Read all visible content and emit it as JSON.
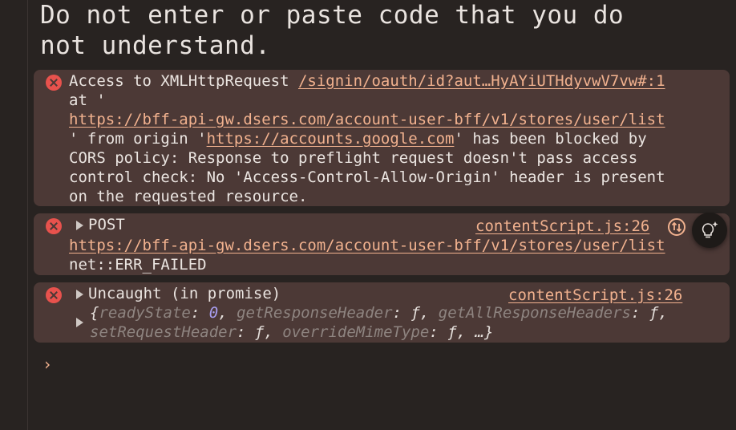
{
  "warning": {
    "line1": "Do not enter or paste code that you do",
    "line2": "not understand."
  },
  "cors_error": {
    "prefix": "Access to XMLHttpRequest ",
    "source_link": "/signin/oauth/id?aut…HyAYiUTHdyvwV7vw#:1",
    "line2": "at '",
    "url": "https://bff-api-gw.dsers.com/account-user-bff/v1/stores/user/list",
    "line4_pre": "' from origin '",
    "origin": "https://accounts.google.com",
    "line4_post": "' has been blocked by",
    "line5": "CORS policy: Response to preflight request doesn't pass access",
    "line6": "control check: No 'Access-Control-Allow-Origin' header is present",
    "line7": "on the requested resource."
  },
  "post_error": {
    "label": "POST",
    "source": "contentScript.js:26",
    "url": "https://bff-api-gw.dsers.com/account-user-bff/v1/stores/user/list",
    "status": "net::ERR_FAILED"
  },
  "promise_error": {
    "label": "Uncaught (in promise)",
    "source": "contentScript.js:26",
    "k1": "readyState",
    "v1": "0",
    "k2": "getResponseHeader",
    "k3": "getAllResponseHeaders",
    "k4": "setRequestHeader",
    "k5": "overrideMimeType",
    "fn": "ƒ",
    "ellipsis": "…"
  },
  "prompt": {
    "symbol": "›"
  },
  "colors": {
    "error_bg": "#4c3936",
    "error_icon": "#e8524d",
    "link": "#f2b28f",
    "background": "#282321"
  },
  "icons": [
    "close-circle-icon",
    "expand-triangle-icon",
    "sync-icon",
    "lightbulb-sparkle-icon",
    "chevron-right-icon"
  ]
}
